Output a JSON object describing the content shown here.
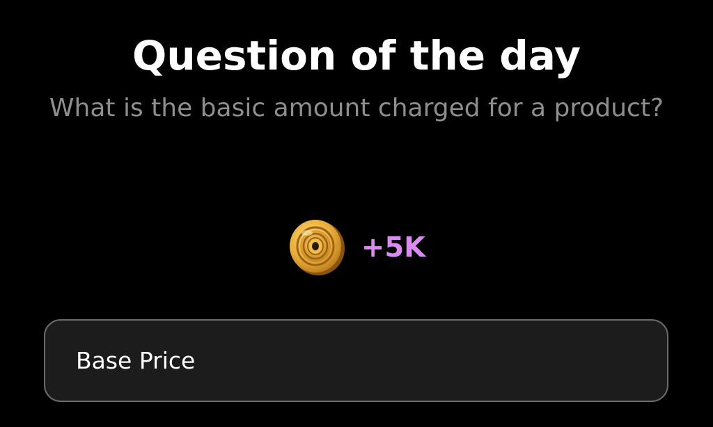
{
  "header": {
    "title": "Question of the day"
  },
  "question": {
    "text": "What is the basic amount charged for a product?"
  },
  "reward": {
    "icon": "coin-icon",
    "amount": "+5K",
    "amount_color": "#d98bf0"
  },
  "answers": [
    {
      "label": "Base Price"
    }
  ]
}
